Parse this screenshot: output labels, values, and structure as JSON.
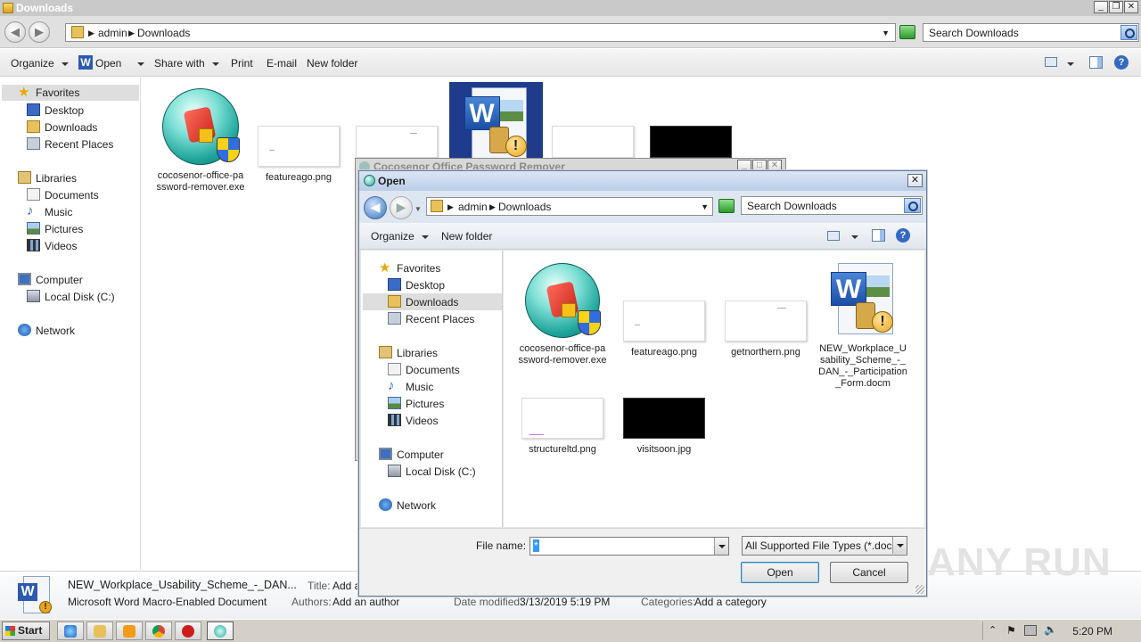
{
  "explorer": {
    "title": "Downloads",
    "breadcrumb": [
      "admin",
      "Downloads"
    ],
    "search_placeholder": "Search Downloads",
    "toolbar": {
      "organize": "Organize",
      "open": "Open",
      "share_with": "Share with",
      "print": "Print",
      "email": "E-mail",
      "new_folder": "New folder"
    },
    "nav": {
      "favorites": "Favorites",
      "desktop": "Desktop",
      "downloads": "Downloads",
      "recent_places": "Recent Places",
      "libraries": "Libraries",
      "documents": "Documents",
      "music": "Music",
      "pictures": "Pictures",
      "videos": "Videos",
      "computer": "Computer",
      "local_disk": "Local Disk (C:)",
      "network": "Network"
    },
    "files": [
      {
        "name": "cocosenor-office-password-remover.exe"
      },
      {
        "name": "featureago.png"
      }
    ],
    "details": {
      "filename": "NEW_Workplace_Usability_Scheme_-_DAN...",
      "filetype": "Microsoft Word Macro-Enabled Document",
      "title_label": "Title:",
      "title_value": "Add a",
      "authors_label": "Authors:",
      "authors_value": "Add an author",
      "date_label": "Date modified:",
      "date_value": "3/13/2019 5:19 PM",
      "categories_label": "Categories:",
      "categories_value": "Add a category"
    }
  },
  "background_dialog": {
    "title": "Cocosenor Office Password Remover"
  },
  "open_dialog": {
    "title": "Open",
    "breadcrumb": [
      "admin",
      "Downloads"
    ],
    "search_placeholder": "Search Downloads",
    "toolbar": {
      "organize": "Organize",
      "new_folder": "New folder"
    },
    "nav": {
      "favorites": "Favorites",
      "desktop": "Desktop",
      "downloads": "Downloads",
      "recent_places": "Recent Places",
      "libraries": "Libraries",
      "documents": "Documents",
      "music": "Music",
      "pictures": "Pictures",
      "videos": "Videos",
      "computer": "Computer",
      "local_disk": "Local Disk (C:)",
      "network": "Network"
    },
    "files": [
      {
        "name": "cocosenor-office-password-remover.exe"
      },
      {
        "name": "featureago.png"
      },
      {
        "name": "getnorthern.png"
      },
      {
        "name": "NEW_Workplace_Usability_Scheme_-_DAN_-_Participation_Form.docm"
      },
      {
        "name": "structureltd.png"
      },
      {
        "name": "visitsoon.jpg"
      }
    ],
    "filename_label": "File name:",
    "filename_value": "*",
    "filetype_value": "All Supported File Types (*.doc;",
    "open_button": "Open",
    "cancel_button": "Cancel"
  },
  "taskbar": {
    "start": "Start",
    "clock": "5:20 PM"
  },
  "watermark": "ANY RUN"
}
